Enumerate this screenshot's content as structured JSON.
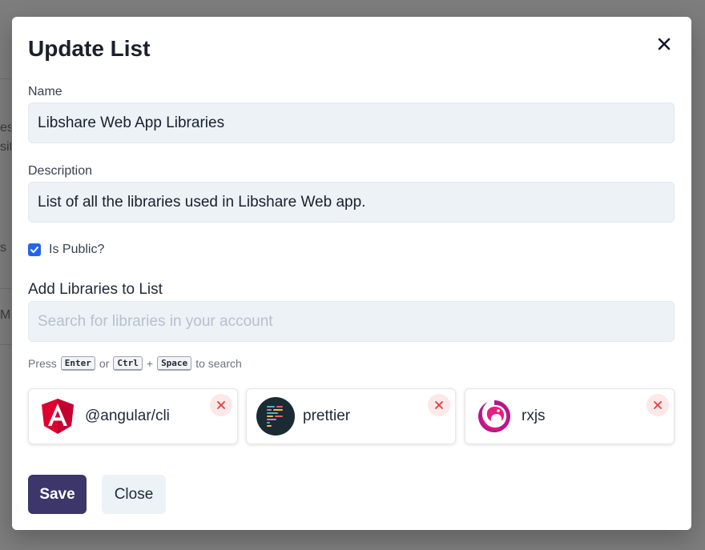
{
  "background": {
    "fragments": [
      "es",
      "site",
      "s",
      "M"
    ]
  },
  "modal": {
    "title": "Update List",
    "close_icon": "close-icon",
    "name": {
      "label": "Name",
      "value": "Libshare Web App Libraries"
    },
    "description": {
      "label": "Description",
      "value": "List of all the libraries used in Libshare Web app."
    },
    "is_public": {
      "label": "Is Public?",
      "checked": true
    },
    "add_libraries": {
      "label": "Add Libraries to List",
      "placeholder": "Search for libraries in your account",
      "hint": {
        "press": "Press",
        "key1": "Enter",
        "or": "or",
        "key2": "Ctrl",
        "plus": "+",
        "key3": "Space",
        "suffix": "to search"
      }
    },
    "libraries": [
      {
        "name": "@angular/cli",
        "icon": "angular-logo-icon"
      },
      {
        "name": "prettier",
        "icon": "prettier-logo-icon"
      },
      {
        "name": "rxjs",
        "icon": "rxjs-logo-icon"
      }
    ],
    "buttons": {
      "save": "Save",
      "close": "Close"
    },
    "colors": {
      "primary": "#3c366b",
      "checkbox": "#2563eb",
      "remove": "#e53e3e"
    }
  }
}
